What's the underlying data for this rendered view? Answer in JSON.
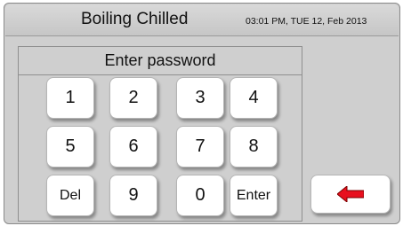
{
  "header": {
    "title": "Boiling Chilled",
    "datetime": "03:01 PM, TUE 12, Feb 2013"
  },
  "keypad": {
    "title": "Enter password",
    "keys": {
      "k1": "1",
      "k2": "2",
      "k3": "3",
      "k4": "4",
      "k5": "5",
      "k6": "6",
      "k7": "7",
      "k8": "8",
      "del": "Del",
      "k9": "9",
      "k0": "0",
      "enter": "Enter"
    }
  },
  "back_button": {
    "icon": "left-arrow-icon",
    "color": "#e8101e"
  },
  "colors": {
    "background": "#cfcfcf",
    "key": "#ffffff",
    "arrow": "#e8101e"
  }
}
